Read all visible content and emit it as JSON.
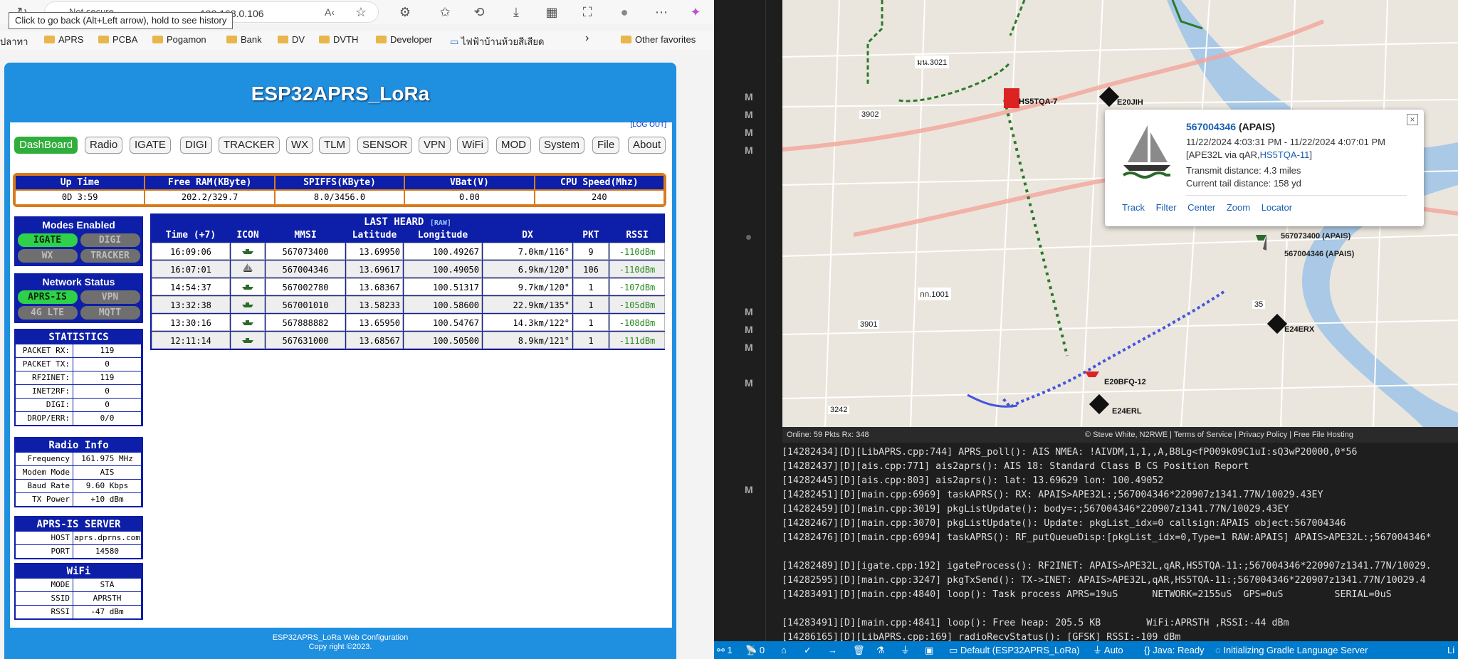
{
  "browser": {
    "url": "192.168.0.106",
    "not_secure": "Not secure",
    "tooltip": "Click to go back (Alt+Left arrow), hold to see history",
    "bookmarks": [
      "ปลาทา",
      "APRS",
      "PCBA",
      "Pogamon",
      "Bank",
      "DV",
      "DVTH",
      "Developer",
      "ไฟฟ้าบ้านห้วยสีเสียด",
      "Other favorites"
    ]
  },
  "page": {
    "title": "ESP32APRS_LoRa",
    "logout": "[LOG OUT]",
    "tabs": [
      "DashBoard",
      "Radio",
      "IGATE",
      "DIGI",
      "TRACKER",
      "WX",
      "TLM",
      "SENSOR",
      "VPN",
      "WiFi",
      "MOD",
      "System",
      "File",
      "About"
    ],
    "footer1": "ESP32APRS_LoRa Web Configuration",
    "footer2": "Copy right ©2023."
  },
  "uptime": {
    "headers": [
      "Up Time",
      "Free RAM(KByte)",
      "SPIFFS(KByte)",
      "VBat(V)",
      "CPU Speed(Mhz)"
    ],
    "values": [
      "0D 3:59",
      "202.2/329.7",
      "8.0/3456.0",
      "0.00",
      "240"
    ]
  },
  "modes": {
    "title": "Modes Enabled",
    "items": [
      {
        "label": "IGATE",
        "on": true
      },
      {
        "label": "DIGI",
        "on": false
      },
      {
        "label": "WX",
        "on": false
      },
      {
        "label": "TRACKER",
        "on": false
      }
    ]
  },
  "network": {
    "title": "Network Status",
    "items": [
      {
        "label": "APRS-IS",
        "on": true
      },
      {
        "label": "VPN",
        "on": false
      },
      {
        "label": "4G LTE",
        "on": false
      },
      {
        "label": "MQTT",
        "on": false
      }
    ]
  },
  "stats": {
    "title": "STATISTICS",
    "rows": [
      [
        "PACKET RX:",
        "119"
      ],
      [
        "PACKET TX:",
        "0"
      ],
      [
        "RF2INET:",
        "119"
      ],
      [
        "INET2RF:",
        "0"
      ],
      [
        "DIGI:",
        "0"
      ],
      [
        "DROP/ERR:",
        "0/0"
      ]
    ]
  },
  "radio": {
    "title": "Radio Info",
    "rows": [
      [
        "Frequency",
        "161.975 MHz"
      ],
      [
        "Modem Mode",
        "AIS"
      ],
      [
        "Baud Rate",
        "9.60 Kbps"
      ],
      [
        "TX Power",
        "+10 dBm"
      ]
    ]
  },
  "aprsis": {
    "title": "APRS-IS SERVER",
    "rows": [
      [
        "HOST",
        "aprs.dprns.com"
      ],
      [
        "PORT",
        "14580"
      ]
    ]
  },
  "wifi": {
    "title": "WiFi",
    "rows": [
      [
        "MODE",
        "STA"
      ],
      [
        "SSID",
        "APRSTH"
      ],
      [
        "RSSI",
        "-47 dBm"
      ]
    ]
  },
  "lastheard": {
    "title": "LAST HEARD",
    "raw": "[RAW]",
    "headers": [
      "Time (+7)",
      "ICON",
      "MMSI",
      "Latitude",
      "Longitude",
      "DX",
      "PKT",
      "RSSI"
    ],
    "rows": [
      [
        "16:09:06",
        "ship-icon",
        "567073400",
        "13.69950",
        "100.49267",
        "7.0km/116°",
        "9",
        "-110dBm"
      ],
      [
        "16:07:01",
        "sailboat-icon",
        "567004346",
        "13.69617",
        "100.49050",
        "6.9km/120°",
        "106",
        "-110dBm"
      ],
      [
        "14:54:37",
        "ship-icon",
        "567002780",
        "13.68367",
        "100.51317",
        "9.7km/120°",
        "1",
        "-107dBm"
      ],
      [
        "13:32:38",
        "ship-icon",
        "567001010",
        "13.58233",
        "100.58600",
        "22.9km/135°",
        "1",
        "-105dBm"
      ],
      [
        "13:30:16",
        "ship-icon",
        "567888882",
        "13.65950",
        "100.54767",
        "14.3km/122°",
        "1",
        "-108dBm"
      ],
      [
        "12:11:14",
        "ship-icon",
        "567631000",
        "13.68567",
        "100.50500",
        "8.9km/121°",
        "1",
        "-111dBm"
      ]
    ]
  },
  "map": {
    "popup": {
      "mmsi": "567004346",
      "type": "(APAIS)",
      "time": "11/22/2024 4:03:31 PM - 11/22/2024 4:07:01 PM",
      "via_pre": "[APE32L via qAR,",
      "via_link": "HS5TQA-11",
      "via_post": "]",
      "distance": "Transmit distance: 4.3 miles",
      "tail": "Current tail distance: 158 yd",
      "links": [
        "Track",
        "Filter",
        "Center",
        "Zoom",
        "Locator"
      ]
    },
    "labels": {
      "e20jih": "E20JIH",
      "hs5tqa": "HS5TQA-7",
      "ship1": "567073400 (APAIS)",
      "ship2": "567004346 (APAIS)",
      "e24erx": "E24ERX",
      "e20bfq": "E20BFQ-12",
      "e24erl": "E24ERL",
      "r3021": "มน.3021",
      "r3902": "3902",
      "r1001": "กก.1001",
      "r3901": "3901",
      "r3242": "3242",
      "r35": "35"
    },
    "status_left": "Online: 59   Pkts Rx: 348",
    "status_right": "© Steve White, N2RWE | Terms of Service | Privacy Policy | Free File Hosting"
  },
  "terminal": [
    "[14282434][D][LibAPRS.cpp:744] APRS_poll(): AIS NMEA: !AIVDM,1,1,,A,B8Lg<fP009k09C1uI:sQ3wP20000,0*56",
    "[14282437][D][ais.cpp:771] ais2aprs(): AIS 18: Standard Class B CS Position Report",
    "[14282445][D][ais.cpp:803] ais2aprs(): lat: 13.69629 lon: 100.49052",
    "[14282451][D][main.cpp:6969] taskAPRS(): RX: APAIS>APE32L:;567004346*220907z1341.77N/10029.43EY",
    "[14282459][D][main.cpp:3019] pkgListUpdate(): body=:;567004346*220907z1341.77N/10029.43EY",
    "[14282467][D][main.cpp:3070] pkgListUpdate(): Update: pkgList_idx=0 callsign:APAIS object:567004346",
    "[14282476][D][main.cpp:6994] taskAPRS(): RF_putQueueDisp:[pkgList_idx=0,Type=1 RAW:APAIS] APAIS>APE32L:;567004346*",
    "",
    "[14282489][D][igate.cpp:192] igateProcess(): RF2INET: APAIS>APE32L,qAR,HS5TQA-11:;567004346*220907z1341.77N/10029.",
    "[14282595][D][main.cpp:3247] pkgTxSend(): TX->INET: APAIS>APE32L,qAR,HS5TQA-11:;567004346*220907z1341.77N/10029.4",
    "[14283491][D][main.cpp:4840] loop(): Task process APRS=19uS      NETWORK=2155uS  GPS=0uS         SERIAL=0uS",
    "",
    "[14283491][D][main.cpp:4841] loop(): Free heap: 205.5 KB        WiFi:APRSTH ,RSSI:-44 dBm",
    "[14286165][D][LibAPRS.cpp:169] radioRecvStatus(): [GFSK] RSSI:-109 dBm"
  ],
  "vsstatus": {
    "ports": "1",
    "radio": "0",
    "env": "Default (ESP32APRS_LoRa)",
    "auto": "Auto",
    "java": "Java: Ready",
    "gradle": "Initializing Gradle Language Server",
    "right": "Li"
  },
  "gutter": [
    "M",
    "M",
    "M",
    "M",
    "M",
    "M",
    "M",
    "M",
    "M"
  ]
}
